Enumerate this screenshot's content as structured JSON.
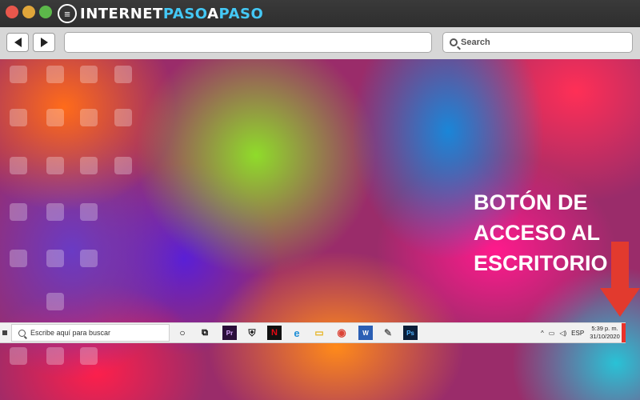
{
  "brand": {
    "logo_letter": "≡",
    "name_part1": "INTERNET",
    "name_part2": "PASO",
    "name_part3": "A",
    "name_part4": "PASO"
  },
  "browser": {
    "back_icon": "back-arrow-icon",
    "forward_icon": "forward-arrow-icon",
    "url_value": "",
    "search_placeholder": "Search"
  },
  "annotation": {
    "line1": "BOTÓN DE",
    "line2": "ACCESO AL",
    "line3": "ESCRITORIO"
  },
  "taskbar": {
    "search_placeholder": "Escribe aquí para buscar",
    "apps": [
      {
        "name": "cortana-icon",
        "glyph": "○"
      },
      {
        "name": "task-view-icon",
        "glyph": "⧉"
      },
      {
        "name": "premiere-icon",
        "glyph": "Pr"
      },
      {
        "name": "shield-icon",
        "glyph": "⛨"
      },
      {
        "name": "netflix-icon",
        "glyph": "N"
      },
      {
        "name": "edge-icon",
        "glyph": "e"
      },
      {
        "name": "file-explorer-icon",
        "glyph": "▭"
      },
      {
        "name": "chrome-icon",
        "glyph": "◉"
      },
      {
        "name": "word-icon",
        "glyph": "W"
      },
      {
        "name": "paint-icon",
        "glyph": "✎"
      },
      {
        "name": "photoshop-icon",
        "glyph": "Ps"
      }
    ],
    "tray_language": "ESP",
    "clock_time": "5:39 p. m.",
    "clock_date": "31/10/2020"
  },
  "colors": {
    "arrow": "#e23a2e",
    "desktop_button": "#e8322a",
    "brand_accent": "#44c8f5"
  }
}
